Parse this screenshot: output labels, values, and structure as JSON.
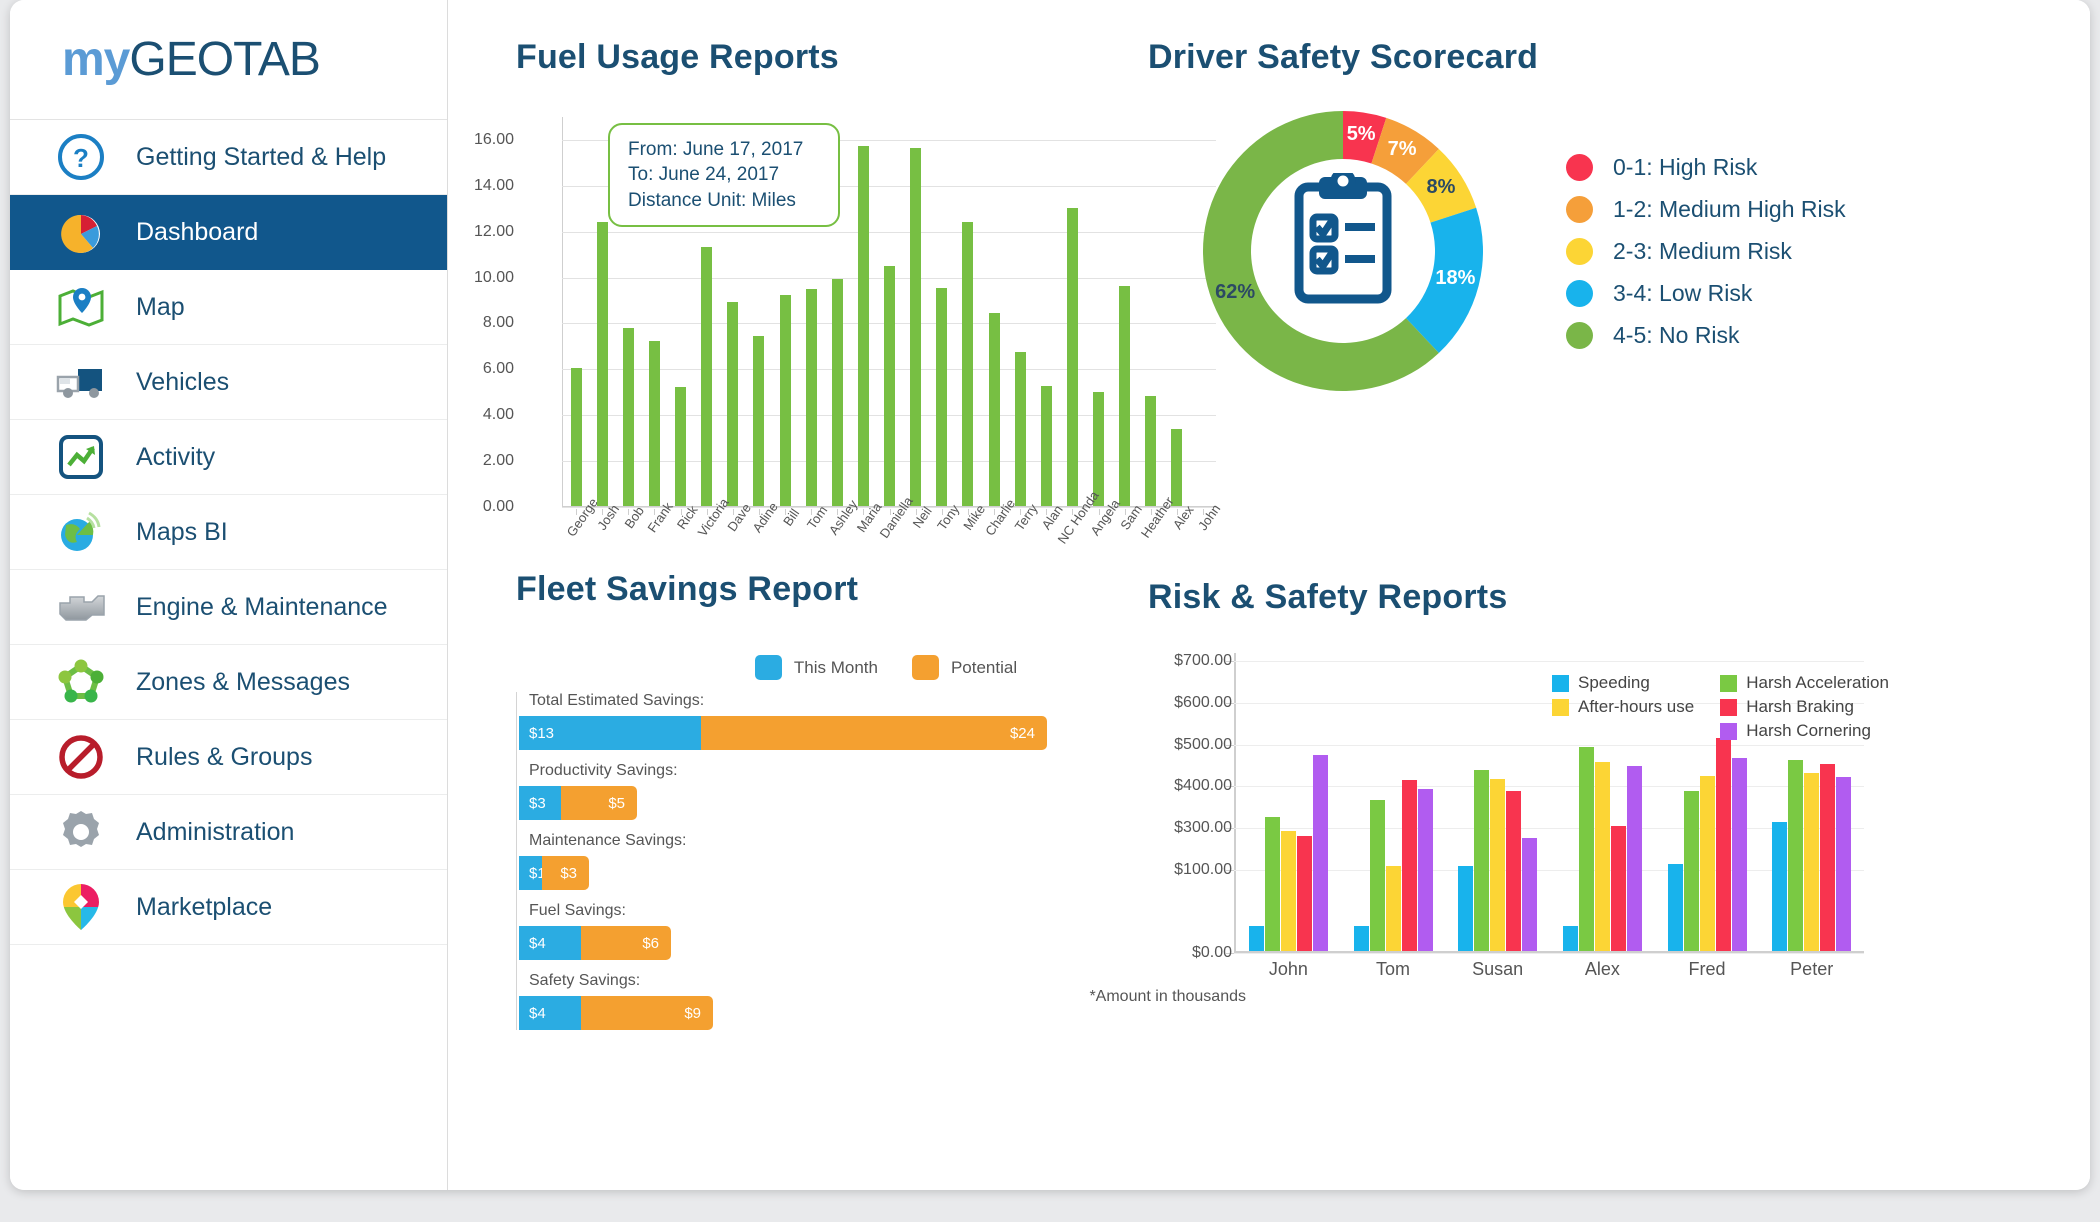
{
  "brand": {
    "my": "my",
    "geotab": "GEOTAB"
  },
  "sidebar": {
    "items": [
      {
        "label": "Getting Started & Help",
        "icon": "help-circle-icon"
      },
      {
        "label": "Dashboard",
        "icon": "pie-chart-icon"
      },
      {
        "label": "Map",
        "icon": "map-pin-icon"
      },
      {
        "label": "Vehicles",
        "icon": "truck-icon"
      },
      {
        "label": "Activity",
        "icon": "activity-graph-icon"
      },
      {
        "label": "Maps BI",
        "icon": "globe-chart-icon"
      },
      {
        "label": "Engine & Maintenance",
        "icon": "engine-icon"
      },
      {
        "label": "Zones & Messages",
        "icon": "zones-nodes-icon"
      },
      {
        "label": "Rules & Groups",
        "icon": "no-entry-icon"
      },
      {
        "label": "Administration",
        "icon": "gear-icon"
      },
      {
        "label": "Marketplace",
        "icon": "marketplace-pin-icon"
      }
    ],
    "active_index": 1
  },
  "fuel": {
    "title": "Fuel Usage Reports",
    "info": {
      "from": "From: June 17, 2017",
      "to": "To: June 24, 2017",
      "unit": "Distance Unit: Miles"
    }
  },
  "safety": {
    "title": "Driver Safety Scorecard",
    "center_icon": "clipboard-checklist-icon",
    "legend": [
      {
        "label": "0-1: High Risk",
        "color": "#f8344f"
      },
      {
        "label": "1-2: Medium High Risk",
        "color": "#f59f3a"
      },
      {
        "label": "2-3: Medium Risk",
        "color": "#fcd535"
      },
      {
        "label": "3-4: Low Risk",
        "color": "#18b3ec"
      },
      {
        "label": "4-5: No Risk",
        "color": "#7ab648"
      }
    ]
  },
  "fleet": {
    "title": "Fleet Savings Report",
    "legend": [
      {
        "label": "This Month",
        "color": "#2bace2"
      },
      {
        "label": "Potential",
        "color": "#f4a030"
      }
    ],
    "note": "*Amount in thousands",
    "rows": [
      {
        "label": "Total Estimated Savings:",
        "this_month": "$13",
        "potential": "$24",
        "this_w": 182,
        "pot_w": 346
      },
      {
        "label": "Productivity Savings:",
        "this_month": "$3",
        "potential": "$5",
        "this_w": 42,
        "pot_w": 76
      },
      {
        "label": "Maintenance Savings:",
        "this_month": "$1",
        "potential": "$3",
        "this_w": 23,
        "pot_w": 47
      },
      {
        "label": "Fuel Savings:",
        "this_month": "$4",
        "potential": "$6",
        "this_w": 62,
        "pot_w": 90
      },
      {
        "label": "Safety Savings:",
        "this_month": "$4",
        "potential": "$9",
        "this_w": 62,
        "pot_w": 132
      }
    ]
  },
  "risk": {
    "title": "Risk & Safety Reports"
  },
  "chart_data": [
    {
      "type": "bar",
      "id": "fuel-usage",
      "title": "Fuel Usage Reports",
      "xlabel": "",
      "ylabel": "",
      "ylim": [
        0,
        17
      ],
      "yticks": [
        "0.00",
        "2.00",
        "4.00",
        "6.00",
        "8.00",
        "10.00",
        "12.00",
        "14.00",
        "16.00"
      ],
      "ytick_values": [
        0,
        2,
        4,
        6,
        8,
        10,
        12,
        14,
        16
      ],
      "grid": true,
      "series_color": "#77bf43",
      "categories": [
        "George",
        "Josh",
        "Bob",
        "Frank",
        "Rick",
        "Victoria",
        "Dave",
        "Adine",
        "Bill",
        "Tom",
        "Ashley",
        "Maria",
        "Daniella",
        "Neil",
        "Tony",
        "Mike",
        "Charlie",
        "Terry",
        "Alan",
        "NC Honda",
        "Angela",
        "Sam",
        "Heather",
        "Alex",
        "John"
      ],
      "values": [
        6.0,
        12.4,
        7.75,
        7.2,
        5.2,
        11.3,
        8.9,
        7.4,
        9.2,
        9.45,
        9.9,
        15.7,
        10.45,
        15.6,
        9.5,
        12.4,
        8.4,
        6.7,
        5.25,
        13.0,
        4.95,
        9.6,
        4.8,
        3.35
      ]
    },
    {
      "type": "pie",
      "id": "driver-safety-scorecard",
      "title": "Driver Safety Scorecard",
      "donut": true,
      "legend_position": "right",
      "labels": [
        "0-1: High Risk",
        "1-2: Medium High Risk",
        "2-3: Medium Risk",
        "3-4: Low Risk",
        "4-5: No Risk"
      ],
      "values": [
        5,
        7,
        8,
        18,
        62
      ],
      "value_labels": [
        "5%",
        "7%",
        "8%",
        "18%",
        "62%"
      ],
      "colors": [
        "#f8344f",
        "#f59f3a",
        "#fcd535",
        "#18b3ec",
        "#7ab648"
      ]
    },
    {
      "type": "bar",
      "id": "fleet-savings",
      "title": "Fleet Savings Report",
      "orientation": "horizontal",
      "stacked": true,
      "note": "*Amount in thousands",
      "categories": [
        "Total Estimated Savings:",
        "Productivity Savings:",
        "Maintenance Savings:",
        "Fuel Savings:",
        "Safety Savings:"
      ],
      "series": [
        {
          "name": "This Month",
          "color": "#2bace2",
          "values": [
            13,
            3,
            1,
            4,
            4
          ],
          "value_labels": [
            "$13",
            "$3",
            "$1",
            "$4",
            "$4"
          ]
        },
        {
          "name": "Potential",
          "color": "#f4a030",
          "values": [
            24,
            5,
            3,
            6,
            9
          ],
          "value_labels": [
            "$24",
            "$5",
            "$3",
            "$6",
            "$9"
          ]
        }
      ]
    },
    {
      "type": "bar",
      "id": "risk-safety",
      "title": "Risk & Safety Reports",
      "grouped": true,
      "ylim": [
        0,
        700
      ],
      "yticks": [
        "$0.00",
        "$100.00",
        "$300.00",
        "$400.00",
        "$500.00",
        "$600.00",
        "$700.00"
      ],
      "ytick_values": [
        0,
        200,
        300,
        400,
        500,
        600,
        700
      ],
      "legend_position": "top-right",
      "categories": [
        "John",
        "Tom",
        "Susan",
        "Alex",
        "Fred",
        "Peter"
      ],
      "series": [
        {
          "name": "Speeding",
          "color": "#18b3ec",
          "values": [
            60,
            60,
            205,
            60,
            208,
            310
          ]
        },
        {
          "name": "Harsh Acceleration",
          "color": "#7ac943",
          "values": [
            322,
            363,
            435,
            490,
            383,
            458
          ]
        },
        {
          "name": "After-hours use",
          "color": "#fcd535",
          "values": [
            288,
            205,
            412,
            453,
            420,
            428
          ]
        },
        {
          "name": "Harsh Braking",
          "color": "#f8344f",
          "values": [
            276,
            410,
            383,
            300,
            512,
            450
          ]
        },
        {
          "name": "Harsh Cornering",
          "color": "#b15cf0",
          "values": [
            470,
            390,
            272,
            443,
            463,
            418
          ]
        }
      ]
    }
  ]
}
